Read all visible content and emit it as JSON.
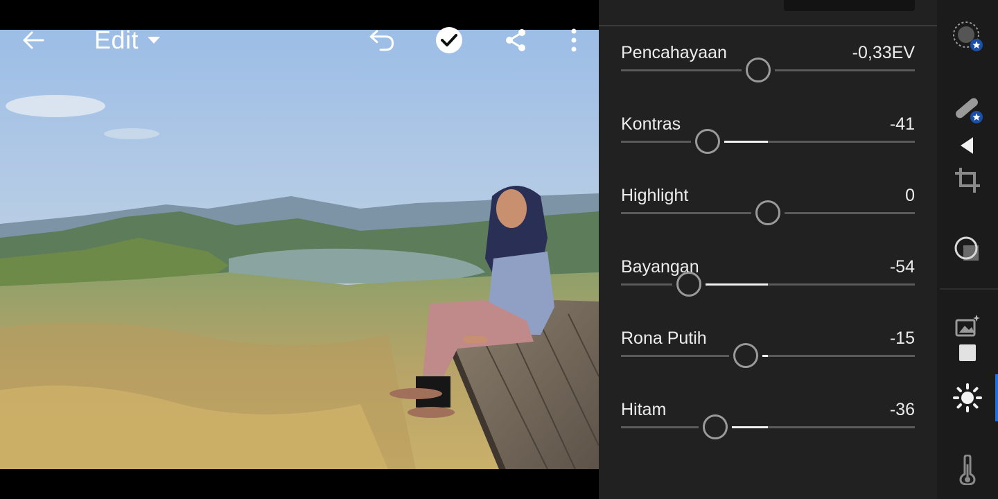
{
  "toolbar": {
    "back_icon": "back-arrow-icon",
    "mode_label": "Edit",
    "mode_dropdown_icon": "caret-down-icon",
    "undo_icon": "undo-icon",
    "done_icon": "checkmark-circle-icon",
    "share_icon": "share-icon",
    "more_icon": "more-vertical-icon"
  },
  "panel": {
    "adjustments": [
      {
        "label": "Pencahayaan",
        "value": "-0,33EV",
        "position": 0.466
      },
      {
        "label": "Kontras",
        "value": "-41",
        "position": 0.295
      },
      {
        "label": "Highlight",
        "value": "0",
        "position": 0.5
      },
      {
        "label": "Bayangan",
        "value": "-54",
        "position": 0.23
      },
      {
        "label": "Rona Putih",
        "value": "-15",
        "position": 0.424
      },
      {
        "label": "Hitam",
        "value": "-36",
        "position": 0.32
      }
    ]
  },
  "rail": {
    "tools": [
      {
        "name": "presets-icon",
        "premium": true
      },
      {
        "name": "healing-brush-icon",
        "premium": true
      },
      {
        "name": "collapse-left-icon"
      },
      {
        "name": "crop-icon"
      },
      {
        "name": "masking-icon"
      },
      {
        "name": "auto-enhance-icon"
      },
      {
        "name": "square-icon"
      },
      {
        "name": "light-icon",
        "active": true
      },
      {
        "name": "color-temperature-icon"
      }
    ],
    "accent_color": "#1473e6"
  }
}
